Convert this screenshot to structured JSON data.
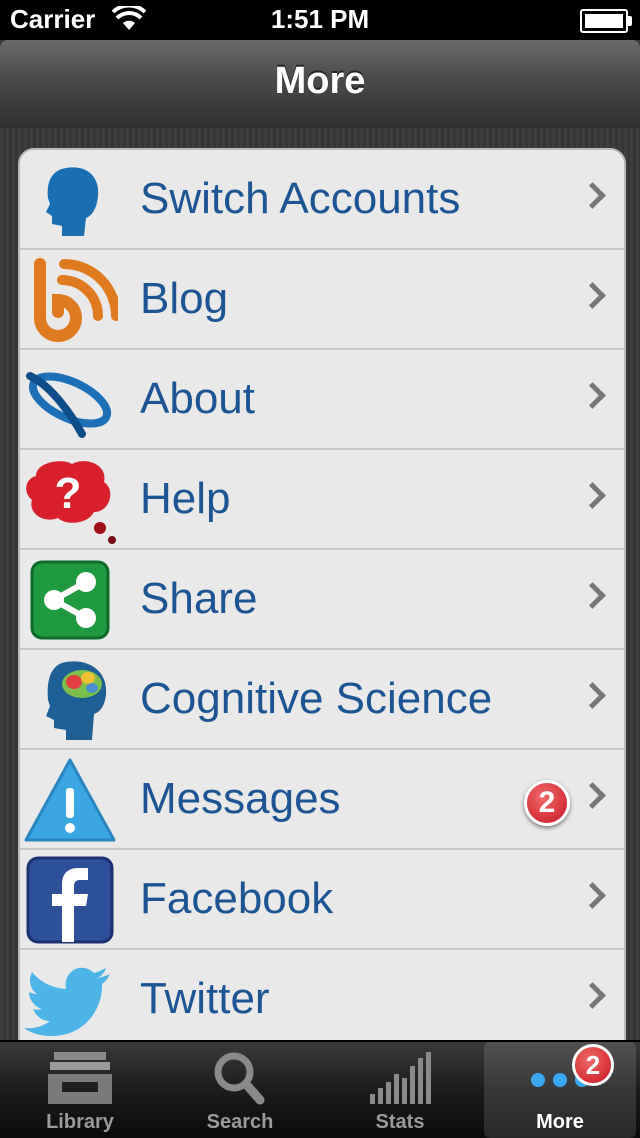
{
  "status_bar": {
    "carrier": "Carrier",
    "time": "1:51 PM"
  },
  "navbar": {
    "title": "More"
  },
  "rows": [
    {
      "label": "Switch Accounts",
      "icon": "head-silhouette-icon"
    },
    {
      "label": "Blog",
      "icon": "rss-blog-icon"
    },
    {
      "label": "About",
      "icon": "orbit-logo-icon"
    },
    {
      "label": "Help",
      "icon": "question-bubble-icon"
    },
    {
      "label": "Share",
      "icon": "share-icon"
    },
    {
      "label": "Cognitive Science",
      "icon": "brain-head-icon"
    },
    {
      "label": "Messages",
      "icon": "warning-triangle-icon",
      "badge": "2"
    },
    {
      "label": "Facebook",
      "icon": "facebook-icon"
    },
    {
      "label": "Twitter",
      "icon": "twitter-bird-icon"
    }
  ],
  "tabs": [
    {
      "label": "Library",
      "icon": "inbox-tray-icon"
    },
    {
      "label": "Search",
      "icon": "magnifier-icon"
    },
    {
      "label": "Stats",
      "icon": "bar-stats-icon"
    },
    {
      "label": "More",
      "icon": "more-dots-icon",
      "badge": "2",
      "selected": true
    }
  ],
  "colors": {
    "label_blue": "#1b5596",
    "badge_red": "#c8141e"
  }
}
